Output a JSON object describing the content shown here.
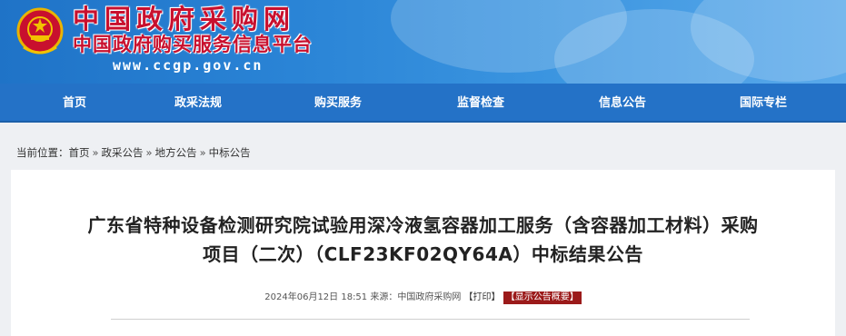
{
  "header": {
    "site_name": "中国政府采购网",
    "site_subname": "中国政府购买服务信息平台",
    "site_url": "www.ccgp.gov.cn",
    "brand_color": "#c8102e",
    "emblem_icon": "national-emblem-icon"
  },
  "nav": {
    "items": [
      {
        "label": "首页"
      },
      {
        "label": "政采法规"
      },
      {
        "label": "购买服务"
      },
      {
        "label": "监督检查"
      },
      {
        "label": "信息公告"
      },
      {
        "label": "国际专栏"
      }
    ],
    "color": "#2472c7"
  },
  "breadcrumb": {
    "prefix": "当前位置：",
    "items": [
      "首页",
      "政采公告",
      "地方公告",
      "中标公告"
    ],
    "separator": "»"
  },
  "article": {
    "title_line1": "广东省特种设备检测研究院试验用深冷液氢容器加工服务（含容器加工材料）采购",
    "title_line2": "项目（二次）（CLF23KF02QY64A）中标结果公告",
    "date": "2024年06月12日 18:51",
    "source_label": "来源：",
    "source": "中国政府采购网",
    "print_label": "【打印】",
    "summary_label": "【显示公告概要】"
  }
}
